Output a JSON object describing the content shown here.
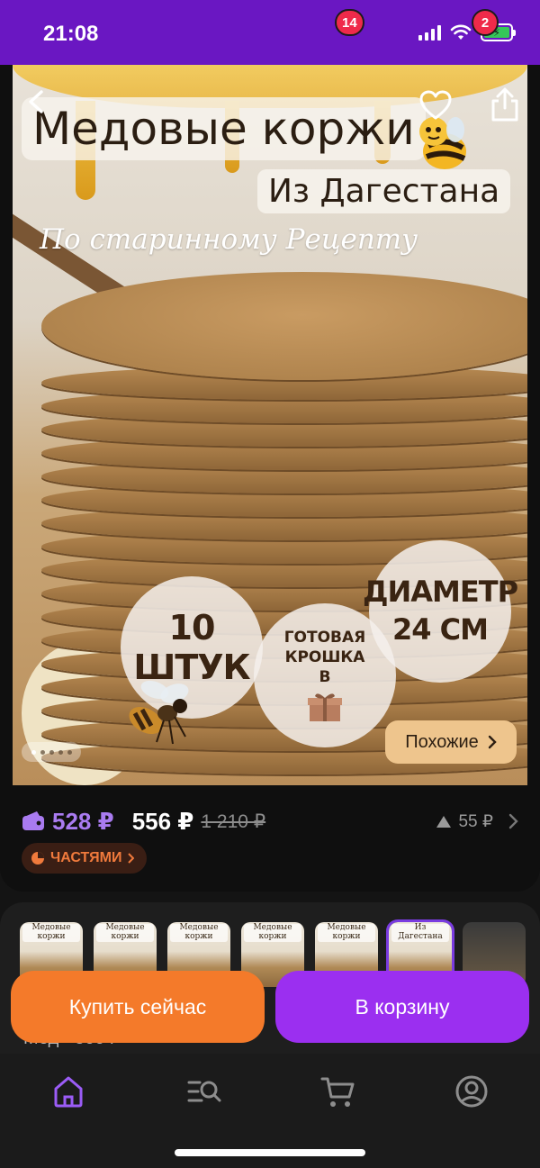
{
  "status_bar": {
    "time": "21:08"
  },
  "product_image": {
    "title": "Медовые коржи",
    "subtitle": "Из Дагестана",
    "script_text": "По старинному Рецепту",
    "badge_count": "10 ШТУК",
    "badge_crumb": [
      "ГОТОВАЯ",
      "КРОШКА",
      "В"
    ],
    "badge_diameter": [
      "ДИАМЕТР",
      "24 СМ"
    ],
    "dots_total": 5,
    "dots_active": 1
  },
  "actions": {
    "similar_label": "Похожие"
  },
  "price": {
    "wallet_price": "528 ₽",
    "price": "556 ₽",
    "old_price": "1 210 ₽",
    "points": "55 ₽"
  },
  "installments": {
    "label": "ЧАСТЯМИ"
  },
  "variants": {
    "thumb_title": "Медовые коржи",
    "thumb_subtitle": "Из Дагестана",
    "count": 7,
    "selected_index": 5,
    "label": "Мед · 500 г"
  },
  "buttons": {
    "buy_now": "Купить сейчас",
    "add_to_cart": "В корзину"
  },
  "bottom_nav": {
    "cart_badge": "14",
    "profile_badge": "2"
  },
  "colors": {
    "accent": "#9b2ff0",
    "orange": "#f47a2a",
    "status_bar": "#6a17c2",
    "badge": "#ef2a4a"
  }
}
